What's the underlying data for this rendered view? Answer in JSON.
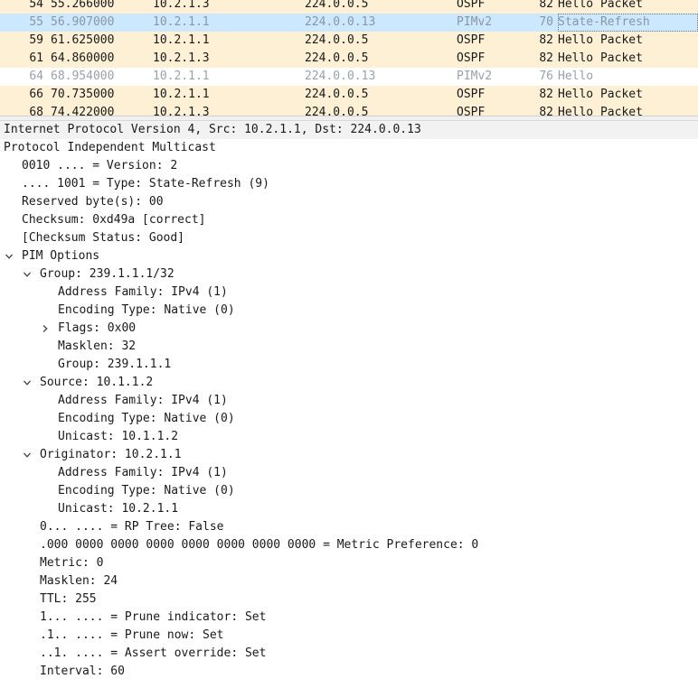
{
  "packet_list": {
    "rows": [
      {
        "no": "54",
        "time": "55.266000",
        "src": "10.2.1.3",
        "dst": "224.0.0.5",
        "proto": "OSPF",
        "len": "82",
        "info": "Hello Packet",
        "kind": "ospf"
      },
      {
        "no": "55",
        "time": "56.907000",
        "src": "10.2.1.1",
        "dst": "224.0.0.13",
        "proto": "PIMv2",
        "len": "70",
        "info": "State-Refresh",
        "kind": "selected"
      },
      {
        "no": "59",
        "time": "61.625000",
        "src": "10.2.1.1",
        "dst": "224.0.0.5",
        "proto": "OSPF",
        "len": "82",
        "info": "Hello Packet",
        "kind": "ospf"
      },
      {
        "no": "61",
        "time": "64.860000",
        "src": "10.2.1.3",
        "dst": "224.0.0.5",
        "proto": "OSPF",
        "len": "82",
        "info": "Hello Packet",
        "kind": "ospf"
      },
      {
        "no": "64",
        "time": "68.954000",
        "src": "10.2.1.1",
        "dst": "224.0.0.13",
        "proto": "PIMv2",
        "len": "76",
        "info": "Hello",
        "kind": "pim"
      },
      {
        "no": "66",
        "time": "70.735000",
        "src": "10.2.1.1",
        "dst": "224.0.0.5",
        "proto": "OSPF",
        "len": "82",
        "info": "Hello Packet",
        "kind": "ospf"
      },
      {
        "no": "68",
        "time": "74.422000",
        "src": "10.2.1.3",
        "dst": "224.0.0.5",
        "proto": "OSPF",
        "len": "82",
        "info": "Hello Packet",
        "kind": "ospf"
      }
    ]
  },
  "details": {
    "rows": [
      {
        "text": "Internet Protocol Version 4, Src: 10.2.1.1, Dst: 224.0.0.13",
        "level": 0,
        "toggle": "none",
        "highlight": true
      },
      {
        "text": "Protocol Independent Multicast",
        "level": 0,
        "toggle": "none"
      },
      {
        "text": "0010 .... = Version: 2",
        "level": 1,
        "toggle": "none"
      },
      {
        "text": ".... 1001 = Type: State-Refresh (9)",
        "level": 1,
        "toggle": "none"
      },
      {
        "text": "Reserved byte(s): 00",
        "level": 1,
        "toggle": "none"
      },
      {
        "text": "Checksum: 0xd49a [correct]",
        "level": 1,
        "toggle": "none"
      },
      {
        "text": "[Checksum Status: Good]",
        "level": 1,
        "toggle": "none"
      },
      {
        "text": "PIM Options",
        "level": 1,
        "toggle": "open"
      },
      {
        "text": "Group: 239.1.1.1/32",
        "level": 2,
        "toggle": "open"
      },
      {
        "text": "Address Family: IPv4 (1)",
        "level": 3,
        "toggle": "none"
      },
      {
        "text": "Encoding Type: Native (0)",
        "level": 3,
        "toggle": "none"
      },
      {
        "text": "Flags: 0x00",
        "level": 3,
        "toggle": "closed"
      },
      {
        "text": "Masklen: 32",
        "level": 3,
        "toggle": "none"
      },
      {
        "text": "Group: 239.1.1.1",
        "level": 3,
        "toggle": "none"
      },
      {
        "text": "Source: 10.1.1.2",
        "level": 2,
        "toggle": "open"
      },
      {
        "text": "Address Family: IPv4 (1)",
        "level": 3,
        "toggle": "none"
      },
      {
        "text": "Encoding Type: Native (0)",
        "level": 3,
        "toggle": "none"
      },
      {
        "text": "Unicast: 10.1.1.2",
        "level": 3,
        "toggle": "none"
      },
      {
        "text": "Originator: 10.2.1.1",
        "level": 2,
        "toggle": "open"
      },
      {
        "text": "Address Family: IPv4 (1)",
        "level": 3,
        "toggle": "none"
      },
      {
        "text": "Encoding Type: Native (0)",
        "level": 3,
        "toggle": "none"
      },
      {
        "text": "Unicast: 10.2.1.1",
        "level": 3,
        "toggle": "none"
      },
      {
        "text": "0... .... = RP Tree: False",
        "level": 2,
        "toggle": "none"
      },
      {
        "text": ".000 0000 0000 0000 0000 0000 0000 0000 = Metric Preference: 0",
        "level": 2,
        "toggle": "none"
      },
      {
        "text": "Metric: 0",
        "level": 2,
        "toggle": "none"
      },
      {
        "text": "Masklen: 24",
        "level": 2,
        "toggle": "none"
      },
      {
        "text": "TTL: 255",
        "level": 2,
        "toggle": "none"
      },
      {
        "text": "1... .... = Prune indicator: Set",
        "level": 2,
        "toggle": "none"
      },
      {
        "text": ".1.. .... = Prune now: Set",
        "level": 2,
        "toggle": "none"
      },
      {
        "text": "..1. .... = Assert override: Set",
        "level": 2,
        "toggle": "none"
      },
      {
        "text": "Interval: 60",
        "level": 2,
        "toggle": "none"
      }
    ]
  },
  "colors": {
    "ospf_row": "#fdf0d5",
    "selected_row": "#cce8ff",
    "pim_text": "#9aa1aa",
    "details_highlight": "#f2f2f2"
  },
  "icons": {
    "expanded": "chevron-down-icon",
    "collapsed": "chevron-right-icon"
  }
}
